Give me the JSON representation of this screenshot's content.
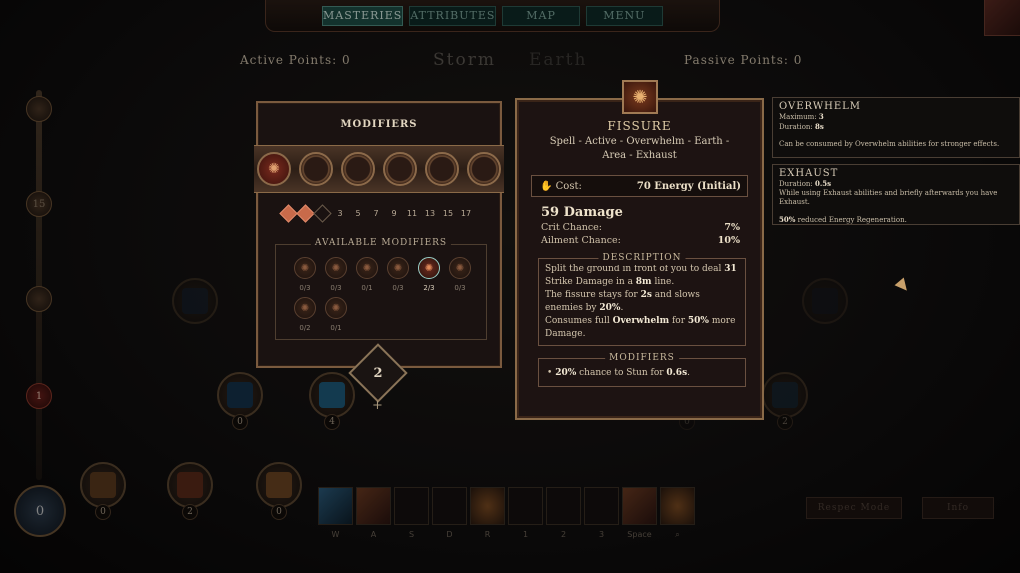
{
  "nav": {
    "tabs": [
      {
        "label": "Masteries",
        "active": true
      },
      {
        "label": "Attributes",
        "active": false
      },
      {
        "label": "Map",
        "active": false
      },
      {
        "label": "Menu",
        "active": false
      }
    ]
  },
  "points": {
    "active_label": "Active Points:",
    "active_value": "0",
    "passive_label": "Passive Points:",
    "passive_value": "0"
  },
  "trees": {
    "primary": "Storm",
    "secondary": "Earth"
  },
  "progress": {
    "level": "0",
    "marker": "1",
    "nodes": [
      "",
      "15",
      ""
    ]
  },
  "tree_nodes": [
    {
      "count": "0"
    },
    {
      "count": "0"
    },
    {
      "count": "2"
    },
    {
      "count": "0"
    },
    {
      "count": "0"
    },
    {
      "count": "4"
    },
    {
      "count": "2"
    }
  ],
  "modifiers_panel": {
    "title": "Modifiers",
    "thresholds": [
      "3",
      "5",
      "7",
      "9",
      "11",
      "13",
      "15",
      "17"
    ],
    "filled_diamonds": 2,
    "available_title": "Available Modifiers",
    "modifiers": [
      {
        "count": "0/3",
        "selected": false
      },
      {
        "count": "0/3",
        "selected": false
      },
      {
        "count": "0/1",
        "selected": false
      },
      {
        "count": "0/3",
        "selected": false
      },
      {
        "count": "2/3",
        "selected": true
      },
      {
        "count": "0/3",
        "selected": false
      },
      {
        "count": "0/2",
        "selected": false
      },
      {
        "count": "0/1",
        "selected": false
      }
    ],
    "points_badge": "2",
    "plus": "+"
  },
  "tooltip": {
    "name": "Fissure",
    "tags": "Spell - Active - Overwhelm - Earth - Area - Exhaust",
    "cost_label": "Cost:",
    "cost_value": "70 Energy (Initial)",
    "damage": "59 Damage",
    "crit_label": "Crit Chance:",
    "crit_value": "7%",
    "ailment_label": "Ailment Chance:",
    "ailment_value": "10%",
    "description_title": "Description",
    "desc": {
      "p1a": "Split the ground in front of you to deal ",
      "p1b": "31",
      "p1c": " Strike Damage in a ",
      "p1d": "8m",
      "p1e": " line.",
      "p2a": "The fissure stays for ",
      "p2b": "2s",
      "p2c": " and slows enemies by ",
      "p2d": "20%",
      "p2e": ".",
      "p3a": "Consumes full ",
      "p3b": "Overwhelm",
      "p3c": " for ",
      "p3d": "50%",
      "p3e": " more Damage."
    },
    "modifiers_title": "Modifiers",
    "mod_line": {
      "bullet": "•",
      "a": "20%",
      "b": " chance to Stun for ",
      "c": "0.6s",
      "d": "."
    }
  },
  "info_boxes": {
    "overwhelm": {
      "title": "Overwhelm",
      "max_label": "Maximum: ",
      "max_value": "3",
      "dur_label": "Duration: ",
      "dur_value": "8s",
      "text": "Can be consumed by Overwhelm abilities for stronger effects."
    },
    "exhaust": {
      "title": "Exhaust",
      "dur_label": "Duration: ",
      "dur_value": "0.5s",
      "text": "While using Exhaust abilities and briefly afterwards you have Exhaust.",
      "effect_a": "50%",
      "effect_b": " reduced Energy Regeneration."
    }
  },
  "hotbar": {
    "keys": [
      "W",
      "A",
      "S",
      "D",
      "R",
      "1",
      "2",
      "3",
      "Space",
      "⌕"
    ]
  },
  "buttons": {
    "respec": "Respec Mode",
    "info": "Info"
  },
  "colors": {
    "accent_teal": "#1e4d45",
    "frame_bronze": "#8a6a48",
    "panel_bg": "#1d1312",
    "diamond_on": "#c86a4a"
  }
}
